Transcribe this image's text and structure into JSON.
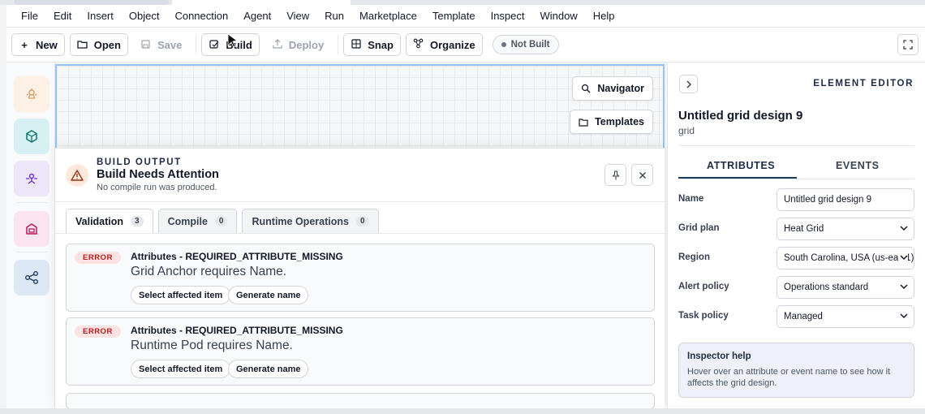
{
  "menubar": {
    "items": [
      "File",
      "Edit",
      "Insert",
      "Object",
      "Connection",
      "Agent",
      "View",
      "Run",
      "Marketplace",
      "Template",
      "Inspect",
      "Window",
      "Help"
    ]
  },
  "toolbar": {
    "new_label": "New",
    "open_label": "Open",
    "save_label": "Save",
    "build_label": "Build",
    "deploy_label": "Deploy",
    "snap_label": "Snap",
    "organize_label": "Organize",
    "status_label": "Not Built"
  },
  "canvas": {
    "navigator_label": "Navigator",
    "templates_label": "Templates"
  },
  "build_output": {
    "eyebrow": "BUILD OUTPUT",
    "title": "Build Needs Attention",
    "subtitle": "No compile run was produced.",
    "tabs": [
      {
        "label": "Validation",
        "count": "3"
      },
      {
        "label": "Compile",
        "count": "0"
      },
      {
        "label": "Runtime Operations",
        "count": "0"
      }
    ],
    "issues": [
      {
        "severity": "ERROR",
        "code": "Attributes - REQUIRED_ATTRIBUTE_MISSING",
        "message": "Grid Anchor requires Name.",
        "action_select": "Select affected item",
        "action_generate": "Generate name"
      },
      {
        "severity": "ERROR",
        "code": "Attributes - REQUIRED_ATTRIBUTE_MISSING",
        "message": "Runtime Pod requires Name.",
        "action_select": "Select affected item",
        "action_generate": "Generate name"
      }
    ]
  },
  "editor": {
    "eyebrow": "ELEMENT EDITOR",
    "title": "Untitled grid design 9",
    "subtitle": "grid",
    "tab_attributes": "ATTRIBUTES",
    "tab_events": "EVENTS",
    "fields": [
      {
        "label": "Name",
        "value": "Untitled grid design 9"
      },
      {
        "label": "Grid plan",
        "value": "Heat Grid"
      },
      {
        "label": "Region",
        "value": "South Carolina, USA (us-east1)"
      },
      {
        "label": "Alert policy",
        "value": "Operations standard"
      },
      {
        "label": "Task policy",
        "value": "Managed"
      }
    ],
    "help_title": "Inspector help",
    "help_text": "Hover over an attribute or event name to see how it affects the grid design."
  },
  "colors": {
    "accent": "#1e3a5f",
    "error": "#b91c1c",
    "canvas_border": "#93c5fd"
  },
  "icons": {
    "rail": [
      "agent-icon",
      "cube-icon",
      "person-node-icon",
      "package-icon",
      "share-graph-icon"
    ]
  }
}
